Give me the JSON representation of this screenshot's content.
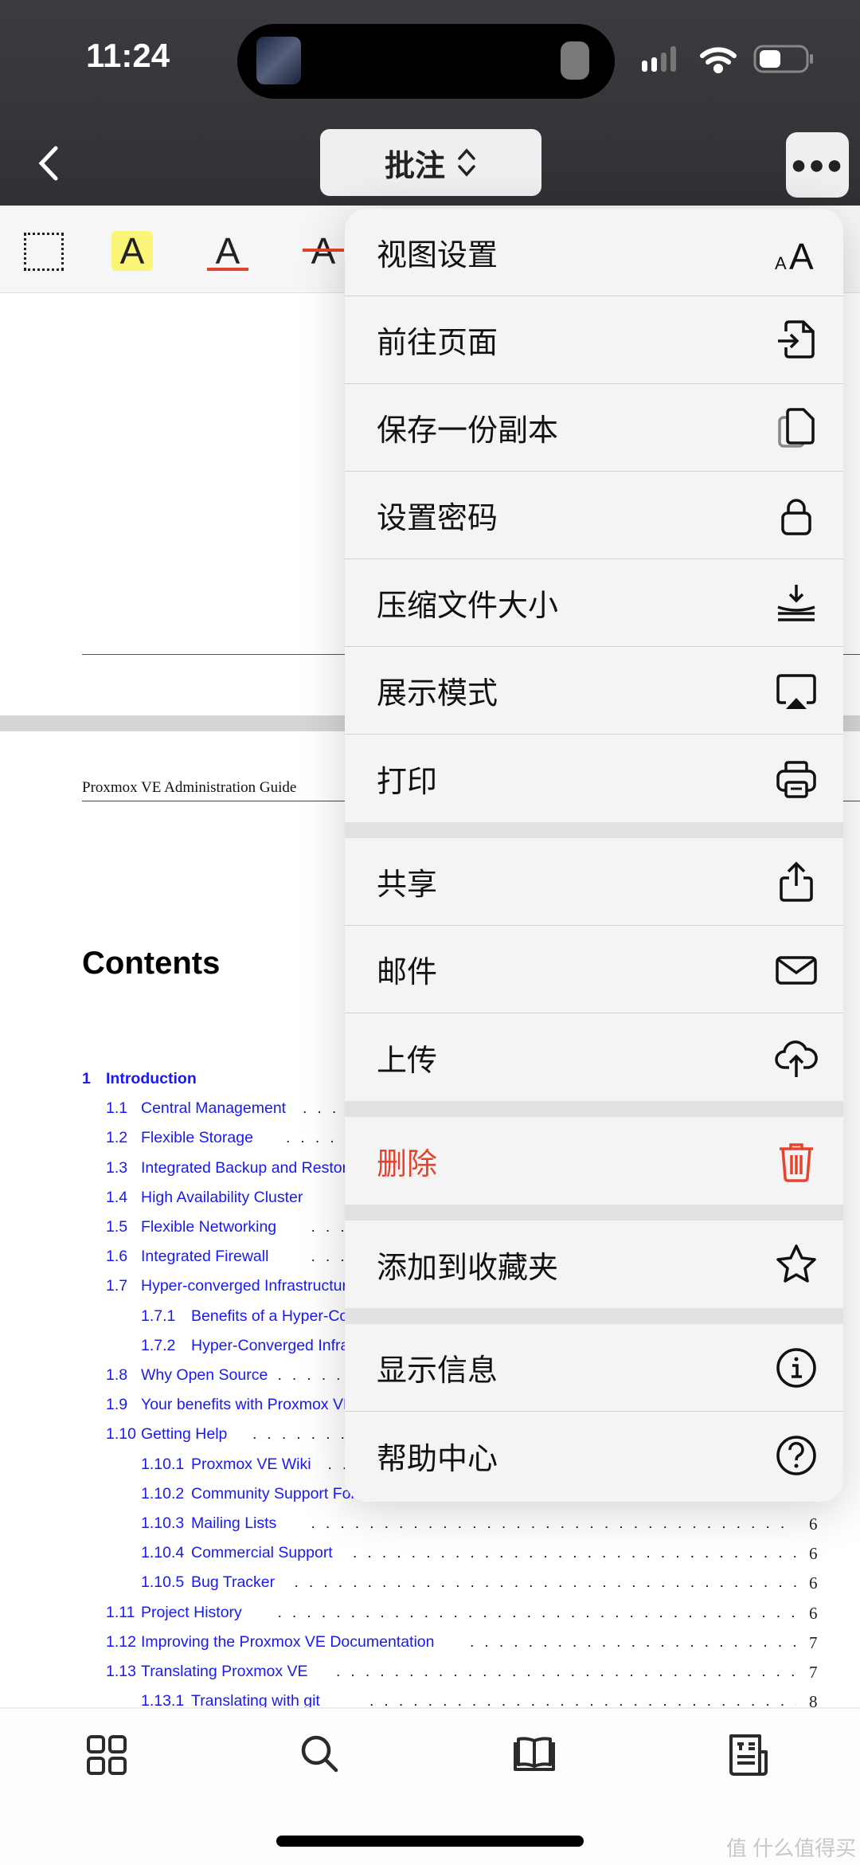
{
  "status_bar": {
    "time": "11:24"
  },
  "nav": {
    "mode_label": "批注",
    "mode_icon": "chevron-up-down-icon",
    "more_icon": "ellipsis-icon",
    "back_icon": "chevron-left-icon"
  },
  "toolbar": {
    "tools": [
      "rect-select-icon",
      "highlight-icon",
      "underline-icon",
      "strikethrough-icon"
    ],
    "tool_glyph": "A",
    "highlight_color": "#fbf67a",
    "underline_color": "#e0422a"
  },
  "document": {
    "running_header": "Proxmox VE Administration Guide",
    "contents_title": "Contents",
    "toc": [
      {
        "num": "1",
        "title": "Introduction",
        "level": 1,
        "page": ""
      },
      {
        "num": "1.1",
        "title": "Central Management",
        "level": 2,
        "page": ""
      },
      {
        "num": "1.2",
        "title": "Flexible Storage",
        "level": 2,
        "page": ""
      },
      {
        "num": "1.3",
        "title": "Integrated Backup and Restore",
        "level": 2,
        "page": ""
      },
      {
        "num": "1.4",
        "title": "High Availability Cluster",
        "level": 2,
        "page": ""
      },
      {
        "num": "1.5",
        "title": "Flexible Networking",
        "level": 2,
        "page": ""
      },
      {
        "num": "1.6",
        "title": "Integrated Firewall",
        "level": 2,
        "page": ""
      },
      {
        "num": "1.7",
        "title": "Hyper-converged Infrastructure",
        "level": 2,
        "page": ""
      },
      {
        "num": "1.7.1",
        "title": "Benefits of a Hyper-Converged",
        "level": 3,
        "page": ""
      },
      {
        "num": "1.7.2",
        "title": "Hyper-Converged Infrastructure",
        "level": 3,
        "page": ""
      },
      {
        "num": "1.8",
        "title": "Why Open Source",
        "level": 2,
        "page": ""
      },
      {
        "num": "1.9",
        "title": "Your benefits with Proxmox VE",
        "level": 2,
        "page": ""
      },
      {
        "num": "1.10",
        "title": "Getting Help",
        "level": 2,
        "page": ""
      },
      {
        "num": "1.10.1",
        "title": "Proxmox VE Wiki",
        "level": 3,
        "page": ""
      },
      {
        "num": "1.10.2",
        "title": "Community Support Forum",
        "level": 3,
        "page": ""
      },
      {
        "num": "1.10.3",
        "title": "Mailing Lists",
        "level": 3,
        "page": "6"
      },
      {
        "num": "1.10.4",
        "title": "Commercial Support",
        "level": 3,
        "page": "6"
      },
      {
        "num": "1.10.5",
        "title": "Bug Tracker",
        "level": 3,
        "page": "6"
      },
      {
        "num": "1.11",
        "title": "Project History",
        "level": 2,
        "page": "6"
      },
      {
        "num": "1.12",
        "title": "Improving the Proxmox VE Documentation",
        "level": 2,
        "page": "7"
      },
      {
        "num": "1.13",
        "title": "Translating Proxmox VE",
        "level": 2,
        "page": "7"
      },
      {
        "num": "1.13.1",
        "title": "Translating with git",
        "level": 3,
        "page": "8"
      }
    ],
    "link_color": "#1a1aee"
  },
  "menu": {
    "groups": [
      [
        {
          "label": "视图设置",
          "icon": "text-size-icon"
        },
        {
          "label": "前往页面",
          "icon": "go-to-page-icon"
        },
        {
          "label": "保存一份副本",
          "icon": "duplicate-icon"
        },
        {
          "label": "设置密码",
          "icon": "lock-icon"
        },
        {
          "label": "压缩文件大小",
          "icon": "compress-icon"
        },
        {
          "label": "展示模式",
          "icon": "airplay-icon"
        },
        {
          "label": "打印",
          "icon": "printer-icon"
        }
      ],
      [
        {
          "label": "共享",
          "icon": "share-icon"
        },
        {
          "label": "邮件",
          "icon": "mail-icon"
        },
        {
          "label": "上传",
          "icon": "cloud-upload-icon"
        }
      ],
      [
        {
          "label": "删除",
          "icon": "trash-icon",
          "destructive": true
        }
      ],
      [
        {
          "label": "添加到收藏夹",
          "icon": "star-icon"
        }
      ],
      [
        {
          "label": "显示信息",
          "icon": "info-icon"
        },
        {
          "label": "帮助中心",
          "icon": "help-icon"
        }
      ]
    ],
    "destructive_color": "#e5432f"
  },
  "tabbar": {
    "items": [
      "thumbnails-icon",
      "search-icon",
      "bookmarks-book-icon",
      "outline-icon"
    ]
  },
  "watermark": "值 什么值得买"
}
